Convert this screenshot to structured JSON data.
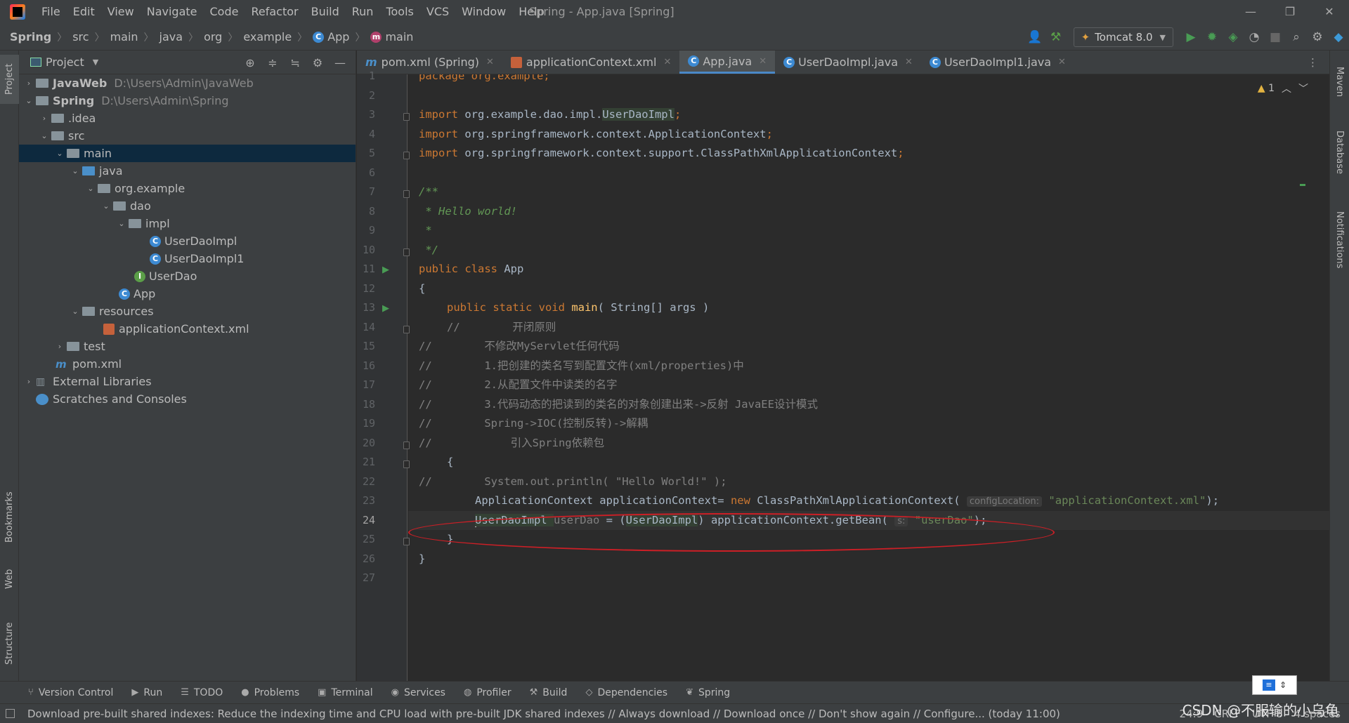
{
  "menu": [
    "File",
    "Edit",
    "View",
    "Navigate",
    "Code",
    "Refactor",
    "Build",
    "Run",
    "Tools",
    "VCS",
    "Window",
    "Help"
  ],
  "window_title": "Spring - App.java [Spring]",
  "breadcrumb": [
    "Spring",
    "src",
    "main",
    "java",
    "org",
    "example",
    "App",
    "main"
  ],
  "run_config": "Tomcat 8.0",
  "project_panel": {
    "title": "Project",
    "tree": [
      {
        "label": "JavaWeb",
        "path": "D:\\Users\\Admin\\JavaWeb"
      },
      {
        "label": "Spring",
        "path": "D:\\Users\\Admin\\Spring"
      },
      {
        "label": ".idea"
      },
      {
        "label": "src"
      },
      {
        "label": "main"
      },
      {
        "label": "java"
      },
      {
        "label": "org.example"
      },
      {
        "label": "dao"
      },
      {
        "label": "impl"
      },
      {
        "label": "UserDaoImpl"
      },
      {
        "label": "UserDaoImpl1"
      },
      {
        "label": "UserDao"
      },
      {
        "label": "App"
      },
      {
        "label": "resources"
      },
      {
        "label": "applicationContext.xml"
      },
      {
        "label": "test"
      },
      {
        "label": "pom.xml"
      },
      {
        "label": "External Libraries"
      },
      {
        "label": "Scratches and Consoles"
      }
    ]
  },
  "tabs": [
    "pom.xml (Spring)",
    "applicationContext.xml",
    "App.java",
    "UserDaoImpl.java",
    "UserDaoImpl1.java"
  ],
  "warning_count": "1",
  "code": {
    "l1": "package org.example;",
    "l3a": "import ",
    "l3b": "org.example.dao.impl.",
    "l3c": "UserDaoImpl",
    "l3d": ";",
    "l4": "org.springframework.context.ApplicationContext",
    "l5": "org.springframework.context.support.ClassPathXmlApplicationContext",
    "l7": "/**",
    "l8": " * Hello world!",
    "l9": " *",
    "l10": " */",
    "l11a": "public class ",
    "l11b": "App",
    "l12": "{",
    "l13a": "public static void ",
    "l13b": "main",
    "l13c": "( String[] args )",
    "l14": "//        开闭原则",
    "l15": "//        不修改MyServlet任何代码",
    "l16": "//        1.把创建的类名写到配置文件(xml/properties)中",
    "l17": "//        2.从配置文件中读类的名字",
    "l18": "//        3.代码动态的把读到的类名的对象创建出来->反射 JavaEE设计模式",
    "l19": "//        Spring->IOC(控制反转)->解耦",
    "l20": "//            引入Spring依赖包",
    "l21": "{",
    "l22": "//        System.out.println( \"Hello World!\" );",
    "l23a": "ApplicationContext applicationContext= ",
    "l23b": "new ",
    "l23c": "ClassPathXmlApplicationContext( ",
    "l23hint": "configLocation:",
    "l23str": "\"applicationContext.xml\"",
    "l23end": ");",
    "l24a": "UserDaoImpl ",
    "l24b": "userDao",
    "l24c": " = (",
    "l24d": "UserDaoImpl",
    "l24e": ") applicationContext.getBean( ",
    "l24hint": "s:",
    "l24str": "\"userDao\"",
    "l24end": ");",
    "l25": "}",
    "l26": "}"
  },
  "tool_tabs": [
    "Version Control",
    "Run",
    "TODO",
    "Problems",
    "Terminal",
    "Services",
    "Profiler",
    "Build",
    "Dependencies",
    "Spring"
  ],
  "left_tabs": [
    "Project",
    "Bookmarks",
    "Web",
    "Structure"
  ],
  "right_tabs": [
    "Maven",
    "Database",
    "Notifications"
  ],
  "status": {
    "message": "Download pre-built shared indexes: Reduce the indexing time and CPU load with pre-built JDK shared indexes // Always download // Download once // Don't show again // Configure... (today 11:00)",
    "position": "24:9",
    "line_sep": "CRLF",
    "encoding": "UTF-8",
    "indent": "4 spaces"
  },
  "watermark": "CSDN @不服输的小乌龟"
}
